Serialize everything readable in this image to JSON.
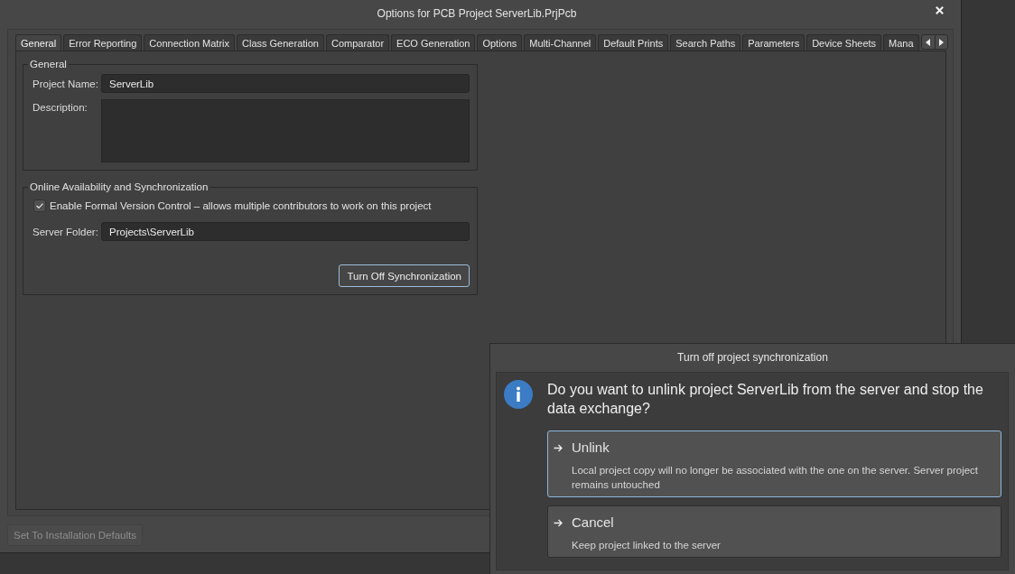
{
  "window": {
    "title": "Options for PCB Project ServerLib.PrjPcb"
  },
  "tabs": [
    {
      "label": "General",
      "selected": true
    },
    {
      "label": "Error Reporting",
      "selected": false
    },
    {
      "label": "Connection Matrix",
      "selected": false
    },
    {
      "label": "Class Generation",
      "selected": false
    },
    {
      "label": "Comparator",
      "selected": false
    },
    {
      "label": "ECO Generation",
      "selected": false
    },
    {
      "label": "Options",
      "selected": false
    },
    {
      "label": "Multi-Channel",
      "selected": false
    },
    {
      "label": "Default Prints",
      "selected": false
    },
    {
      "label": "Search Paths",
      "selected": false
    },
    {
      "label": "Parameters",
      "selected": false
    },
    {
      "label": "Device Sheets",
      "selected": false
    },
    {
      "label": "Mana",
      "selected": false
    }
  ],
  "general": {
    "title": "General",
    "fields": [
      {
        "kind": "text",
        "label": "Project Name:",
        "value": "ServerLib"
      },
      {
        "kind": "multiline",
        "label": "Description:"
      }
    ]
  },
  "synchronization": {
    "title": "Online Availability and Synchronization",
    "formal_version_control": {
      "label": "Enable Formal Version Control – allows multiple contributors to work on this project",
      "checked": true
    },
    "server_folder": {
      "label": "Server Folder:",
      "value": "Projects\\ServerLib"
    },
    "turn_off_button": {
      "label": "Turn Off Synchronization",
      "focused": true
    }
  },
  "defaults_button": {
    "label": "Set To Installation Defaults",
    "disabled": true
  },
  "confirm_dialog": {
    "title": "Turn off project synchronization",
    "message": "Do you want to unlink project ServerLib from the server and stop the data exchange?",
    "options": [
      {
        "label": "Unlink",
        "description": "Local project copy will no longer be associated with the one on the server. Server project remains untouched",
        "selected": true
      },
      {
        "label": "Cancel",
        "description": "Keep project linked to the server",
        "selected": false
      }
    ]
  }
}
